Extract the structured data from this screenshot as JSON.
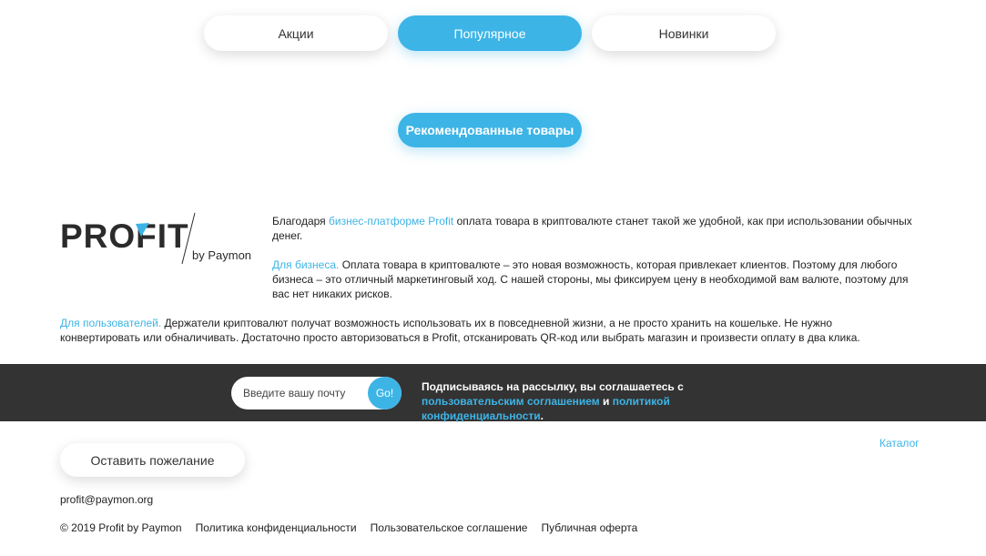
{
  "tabs": [
    {
      "label": "Акции",
      "active": false
    },
    {
      "label": "Популярное",
      "active": true
    },
    {
      "label": "Новинки",
      "active": false
    }
  ],
  "recommended_button": "Рекомендованные товары",
  "logo": {
    "wordmark": "PROFIT",
    "by": "by Paymon"
  },
  "about": {
    "p1": {
      "prefix": "Благодаря ",
      "link": "бизнес-платформе Profit",
      "suffix": " оплата товара в криптовалюте станет такой же удобной, как при использовании обычных денег."
    },
    "p2": {
      "link": "Для бизнеса.",
      "text": " Оплата товара в криптовалюте – это новая возможность, которая привлекает клиентов. Поэтому для любого бизнеса – это отличный маркетинговый ход. С нашей стороны, мы фиксируем цену в необходимой вам валюте, поэтому для вас нет никаких рисков."
    },
    "p3": {
      "link": "Для пользователей.",
      "text": " Держатели криптовалют получат возможность использовать их в повседневной жизни, а не просто хранить на кошельке. Не нужно конвертировать или обналичивать. Достаточно просто авторизоваться в Profit, отсканировать QR-код или выбрать магазин и произвести оплату в два клика."
    }
  },
  "subscribe": {
    "placeholder": "Введите вашу почту",
    "go_label": "Go!",
    "text_prefix": "Подписываясь на рассылку, вы соглашаетесь с ",
    "link1": "пользовательским соглашением",
    "text_mid": " и ",
    "link2": "политикой конфиденциальности",
    "text_end": "."
  },
  "wish_button": "Оставить пожелание",
  "catalog_link": "Каталог",
  "contact_email": "profit@paymon.org",
  "footer": {
    "copyright": "© 2019 Profit by Paymon",
    "links": [
      "Политика конфиденциальности",
      "Пользовательское соглашение",
      "Публичная оферта"
    ]
  },
  "colors": {
    "accent": "#3db4e6",
    "dark_bar": "#333333",
    "logo_text": "#2b2b2b"
  }
}
